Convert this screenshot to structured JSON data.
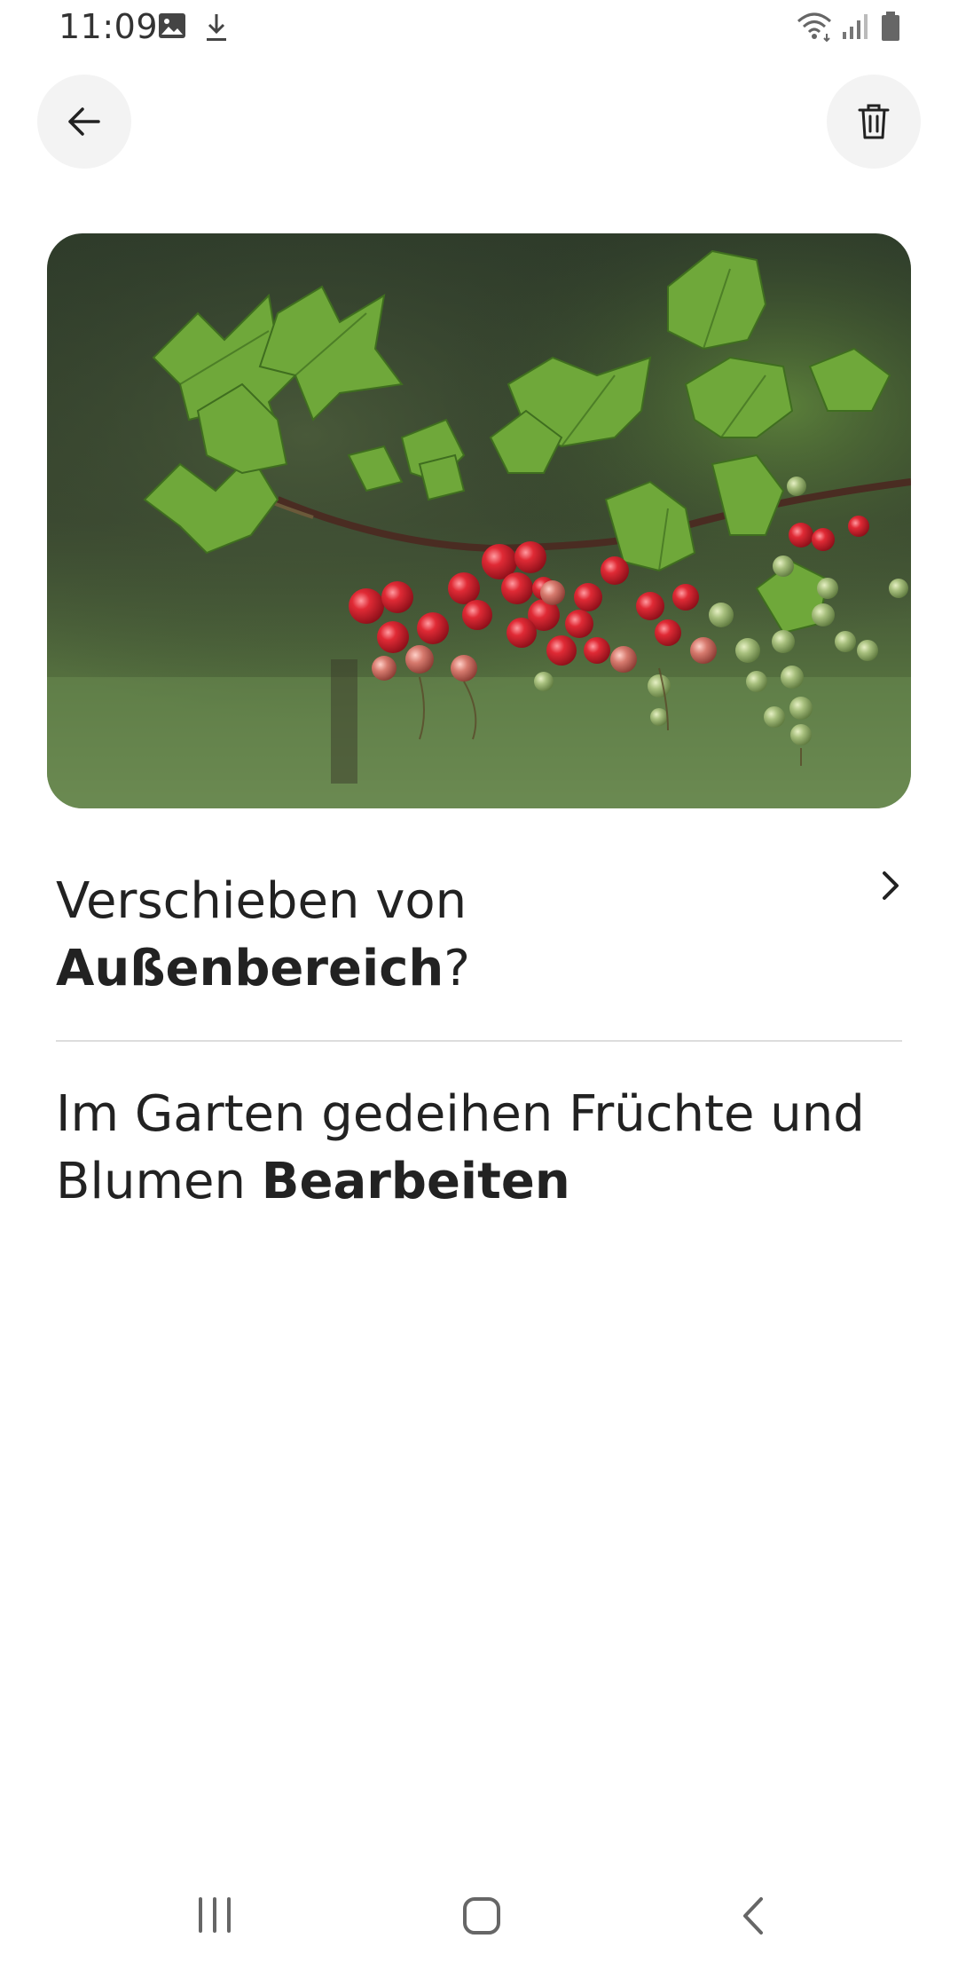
{
  "status_bar": {
    "time": "11:09",
    "icons": [
      "image-icon",
      "download-icon",
      "wifi-icon",
      "signal-icon",
      "battery-icon"
    ]
  },
  "toolbar": {
    "back_icon": "arrow-left-icon",
    "delete_icon": "trash-icon"
  },
  "hero": {
    "alt": "Zweig mit roten und grünen Johannisbeeren"
  },
  "move": {
    "prefix": "Verschieben von",
    "location": "Außenbereich",
    "suffix": "?"
  },
  "description": {
    "text": "Im Garten gedeihen Früchte und Blumen",
    "edit_label": "Bearbeiten"
  },
  "navbar": {
    "icons": [
      "recents-icon",
      "home-icon",
      "back-icon"
    ]
  },
  "colors": {
    "button_bg": "#f3f3f3",
    "text": "#222222",
    "divider": "#dddddd"
  }
}
